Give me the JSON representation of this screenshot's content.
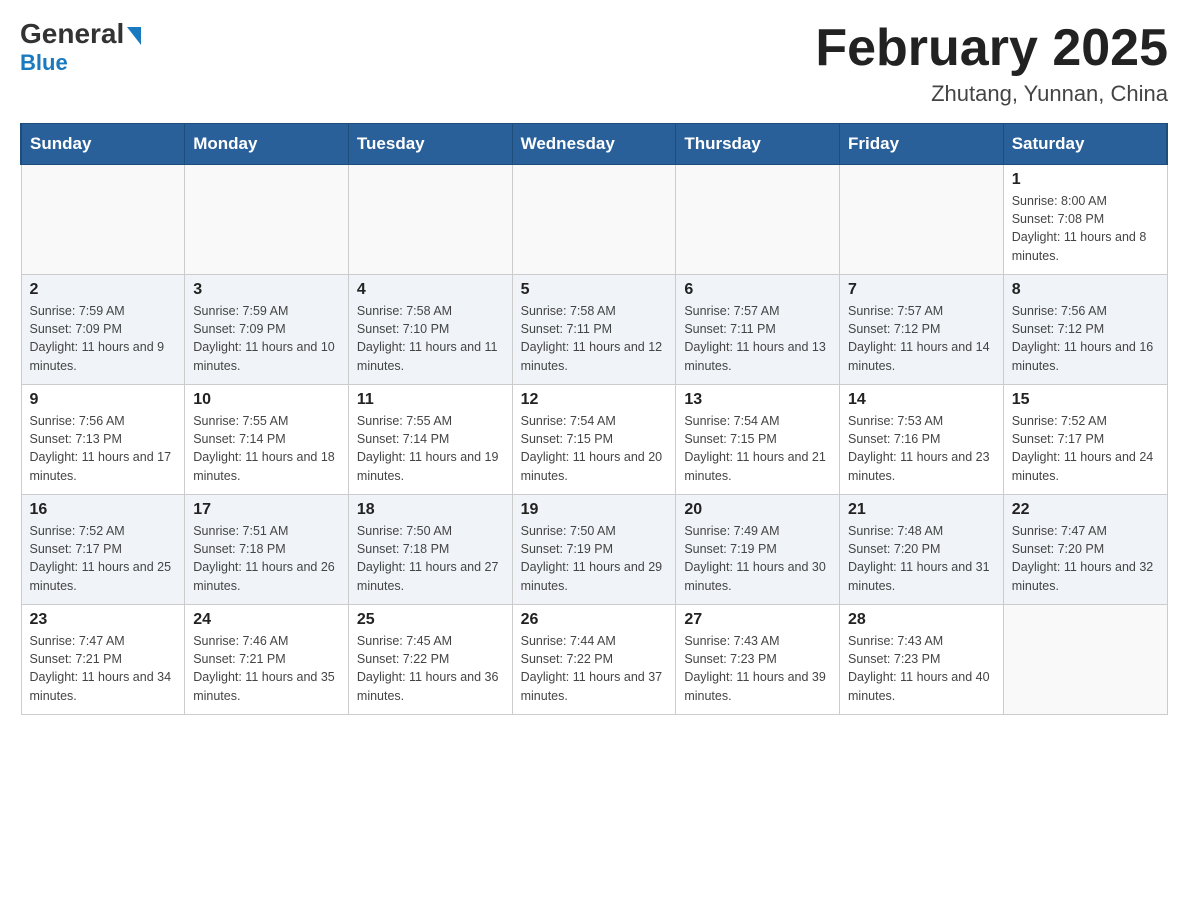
{
  "header": {
    "logo_general": "General",
    "logo_blue": "Blue",
    "month_title": "February 2025",
    "location": "Zhutang, Yunnan, China"
  },
  "days_of_week": [
    "Sunday",
    "Monday",
    "Tuesday",
    "Wednesday",
    "Thursday",
    "Friday",
    "Saturday"
  ],
  "weeks": [
    [
      {
        "day": "",
        "info": ""
      },
      {
        "day": "",
        "info": ""
      },
      {
        "day": "",
        "info": ""
      },
      {
        "day": "",
        "info": ""
      },
      {
        "day": "",
        "info": ""
      },
      {
        "day": "",
        "info": ""
      },
      {
        "day": "1",
        "info": "Sunrise: 8:00 AM\nSunset: 7:08 PM\nDaylight: 11 hours and 8 minutes."
      }
    ],
    [
      {
        "day": "2",
        "info": "Sunrise: 7:59 AM\nSunset: 7:09 PM\nDaylight: 11 hours and 9 minutes."
      },
      {
        "day": "3",
        "info": "Sunrise: 7:59 AM\nSunset: 7:09 PM\nDaylight: 11 hours and 10 minutes."
      },
      {
        "day": "4",
        "info": "Sunrise: 7:58 AM\nSunset: 7:10 PM\nDaylight: 11 hours and 11 minutes."
      },
      {
        "day": "5",
        "info": "Sunrise: 7:58 AM\nSunset: 7:11 PM\nDaylight: 11 hours and 12 minutes."
      },
      {
        "day": "6",
        "info": "Sunrise: 7:57 AM\nSunset: 7:11 PM\nDaylight: 11 hours and 13 minutes."
      },
      {
        "day": "7",
        "info": "Sunrise: 7:57 AM\nSunset: 7:12 PM\nDaylight: 11 hours and 14 minutes."
      },
      {
        "day": "8",
        "info": "Sunrise: 7:56 AM\nSunset: 7:12 PM\nDaylight: 11 hours and 16 minutes."
      }
    ],
    [
      {
        "day": "9",
        "info": "Sunrise: 7:56 AM\nSunset: 7:13 PM\nDaylight: 11 hours and 17 minutes."
      },
      {
        "day": "10",
        "info": "Sunrise: 7:55 AM\nSunset: 7:14 PM\nDaylight: 11 hours and 18 minutes."
      },
      {
        "day": "11",
        "info": "Sunrise: 7:55 AM\nSunset: 7:14 PM\nDaylight: 11 hours and 19 minutes."
      },
      {
        "day": "12",
        "info": "Sunrise: 7:54 AM\nSunset: 7:15 PM\nDaylight: 11 hours and 20 minutes."
      },
      {
        "day": "13",
        "info": "Sunrise: 7:54 AM\nSunset: 7:15 PM\nDaylight: 11 hours and 21 minutes."
      },
      {
        "day": "14",
        "info": "Sunrise: 7:53 AM\nSunset: 7:16 PM\nDaylight: 11 hours and 23 minutes."
      },
      {
        "day": "15",
        "info": "Sunrise: 7:52 AM\nSunset: 7:17 PM\nDaylight: 11 hours and 24 minutes."
      }
    ],
    [
      {
        "day": "16",
        "info": "Sunrise: 7:52 AM\nSunset: 7:17 PM\nDaylight: 11 hours and 25 minutes."
      },
      {
        "day": "17",
        "info": "Sunrise: 7:51 AM\nSunset: 7:18 PM\nDaylight: 11 hours and 26 minutes."
      },
      {
        "day": "18",
        "info": "Sunrise: 7:50 AM\nSunset: 7:18 PM\nDaylight: 11 hours and 27 minutes."
      },
      {
        "day": "19",
        "info": "Sunrise: 7:50 AM\nSunset: 7:19 PM\nDaylight: 11 hours and 29 minutes."
      },
      {
        "day": "20",
        "info": "Sunrise: 7:49 AM\nSunset: 7:19 PM\nDaylight: 11 hours and 30 minutes."
      },
      {
        "day": "21",
        "info": "Sunrise: 7:48 AM\nSunset: 7:20 PM\nDaylight: 11 hours and 31 minutes."
      },
      {
        "day": "22",
        "info": "Sunrise: 7:47 AM\nSunset: 7:20 PM\nDaylight: 11 hours and 32 minutes."
      }
    ],
    [
      {
        "day": "23",
        "info": "Sunrise: 7:47 AM\nSunset: 7:21 PM\nDaylight: 11 hours and 34 minutes."
      },
      {
        "day": "24",
        "info": "Sunrise: 7:46 AM\nSunset: 7:21 PM\nDaylight: 11 hours and 35 minutes."
      },
      {
        "day": "25",
        "info": "Sunrise: 7:45 AM\nSunset: 7:22 PM\nDaylight: 11 hours and 36 minutes."
      },
      {
        "day": "26",
        "info": "Sunrise: 7:44 AM\nSunset: 7:22 PM\nDaylight: 11 hours and 37 minutes."
      },
      {
        "day": "27",
        "info": "Sunrise: 7:43 AM\nSunset: 7:23 PM\nDaylight: 11 hours and 39 minutes."
      },
      {
        "day": "28",
        "info": "Sunrise: 7:43 AM\nSunset: 7:23 PM\nDaylight: 11 hours and 40 minutes."
      },
      {
        "day": "",
        "info": ""
      }
    ]
  ]
}
